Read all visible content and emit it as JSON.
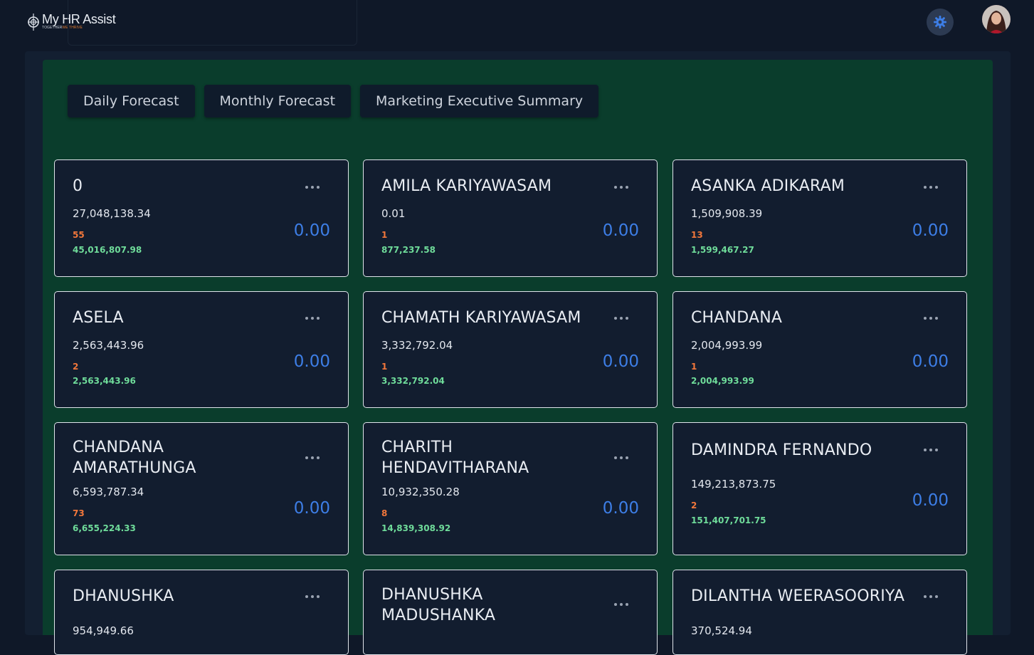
{
  "header": {
    "logo_title": "My HR Assist",
    "logo_tagline_a": "TOGETHER",
    "logo_tagline_b": "WE THRIVE",
    "theme_icon": "gear-icon",
    "accent_color": "#3d7ee6"
  },
  "tabs": [
    {
      "label": "Daily Forecast"
    },
    {
      "label": "Monthly Forecast"
    },
    {
      "label": "Marketing Executive Summary"
    }
  ],
  "colors": {
    "count": "#f2773b",
    "total": "#6fdc9a",
    "value": "#3d7ee6",
    "panel": "#0a3d2c"
  },
  "cards": [
    {
      "name": "0",
      "amount": "27,048,138.34",
      "count": "55",
      "total": "45,016,807.98",
      "value": "0.00"
    },
    {
      "name": "AMILA KARIYAWASAM",
      "amount": "0.01",
      "count": "1",
      "total": "877,237.58",
      "value": "0.00"
    },
    {
      "name": "ASANKA ADIKARAM",
      "amount": "1,509,908.39",
      "count": "13",
      "total": "1,599,467.27",
      "value": "0.00"
    },
    {
      "name": "ASELA",
      "amount": "2,563,443.96",
      "count": "2",
      "total": "2,563,443.96",
      "value": "0.00"
    },
    {
      "name": "CHAMATH KARIYAWASAM",
      "amount": "3,332,792.04",
      "count": "1",
      "total": "3,332,792.04",
      "value": "0.00"
    },
    {
      "name": "CHANDANA",
      "amount": "2,004,993.99",
      "count": "1",
      "total": "2,004,993.99",
      "value": "0.00"
    },
    {
      "name": "CHANDANA AMARATHUNGA",
      "amount": "6,593,787.34",
      "count": "73",
      "total": "6,655,224.33",
      "value": "0.00"
    },
    {
      "name": "CHARITH HENDAVITHARANA",
      "amount": "10,932,350.28",
      "count": "8",
      "total": "14,839,308.92",
      "value": "0.00"
    },
    {
      "name": "DAMINDRA FERNANDO",
      "amount": "149,213,873.75",
      "count": "2",
      "total": "151,407,701.75",
      "value": "0.00"
    },
    {
      "name": "DHANUSHKA",
      "amount": "954,949.66"
    },
    {
      "name": "DHANUSHKA MADUSHANKA"
    },
    {
      "name": "DILANTHA WEERASOORIYA",
      "amount": "370,524.94"
    }
  ]
}
